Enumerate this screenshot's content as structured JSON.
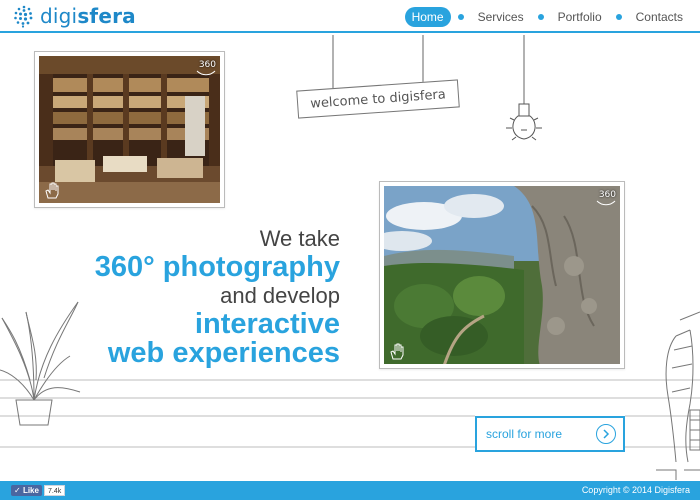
{
  "header": {
    "logo": {
      "part1": "digi",
      "part2": "sfera"
    },
    "nav": [
      {
        "label": "Home",
        "active": true
      },
      {
        "label": "Services",
        "active": false
      },
      {
        "label": "Portfolio",
        "active": false
      },
      {
        "label": "Contacts",
        "active": false
      }
    ]
  },
  "sign": {
    "text": "welcome to digisfera"
  },
  "photos": [
    {
      "badge": "360",
      "subject": "bookstore interior"
    },
    {
      "badge": "360",
      "subject": "garden with carved stone"
    }
  ],
  "hero": {
    "line1": "We take",
    "line2": "360° photography",
    "line3": "and develop",
    "line4": "interactive",
    "line5": "web experiences"
  },
  "scroll": {
    "label": "scroll for more"
  },
  "footer": {
    "like_label": "Like",
    "like_count": "7.4k",
    "copyright": "Copyright © 2014 Digisfera"
  },
  "colors": {
    "accent": "#29a3de",
    "logo": "#1e88c8",
    "text": "#444444"
  }
}
